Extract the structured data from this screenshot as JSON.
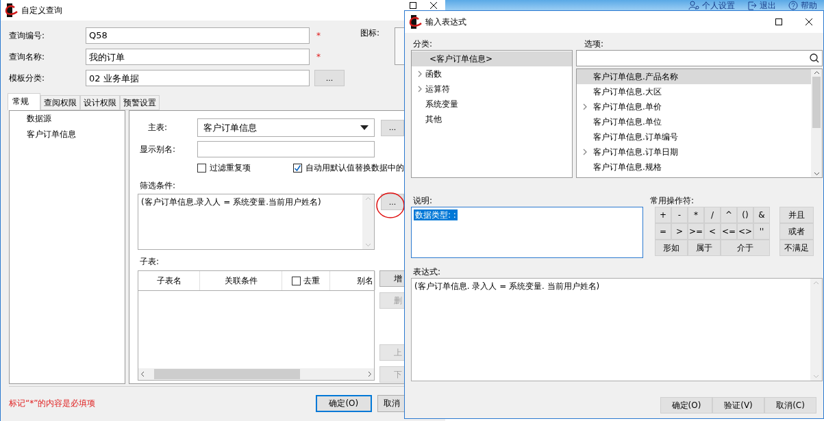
{
  "top_bar": {
    "links": [
      {
        "label": "个人设置"
      },
      {
        "label": "退出"
      },
      {
        "label": "帮助"
      }
    ]
  },
  "main_window": {
    "title": "自定义查询",
    "fields": [
      {
        "label": "查询编号:",
        "value": "Q58",
        "required": true
      },
      {
        "label": "查询名称:",
        "value": "我的订单",
        "required": true
      },
      {
        "label": "模板分类:",
        "value": "02 业务单据",
        "required": false,
        "browse": "..."
      }
    ],
    "icon_label": "图标:",
    "tabs": [
      {
        "label": "常规",
        "selected": true
      },
      {
        "label": "查阅权限",
        "selected": false
      },
      {
        "label": "设计权限",
        "selected": false
      },
      {
        "label": "预警设置",
        "selected": false
      }
    ],
    "tree": [
      {
        "label": "数据源"
      },
      {
        "label": "客户订单信息"
      }
    ],
    "main_table": {
      "label": "主表:",
      "value": "客户订单信息",
      "browse": "..."
    },
    "alias": {
      "label": "显示别名:"
    },
    "options": [
      {
        "label": "过滤重复项",
        "checked": false
      },
      {
        "label": "自动用默认值替换数据中的",
        "checked": true
      }
    ],
    "filter": {
      "label": "筛选条件:",
      "value": "(客户订单信息.录入人 = 系统变量.当前用户姓名)",
      "browse": "..."
    },
    "subtable": {
      "label": "子表:",
      "columns": [
        {
          "label": "子表名",
          "kind": "text"
        },
        {
          "label": "关联条件",
          "kind": "text"
        },
        {
          "label": "去重",
          "kind": "checkbox",
          "checked": false
        },
        {
          "label": "别名",
          "kind": "text"
        }
      ],
      "buttons": [
        {
          "label": "增",
          "disabled": false
        },
        {
          "label": "删",
          "disabled": true
        },
        {
          "label": "上",
          "disabled": true
        },
        {
          "label": "下",
          "disabled": true
        }
      ]
    },
    "footer": {
      "note": "标记“*”的内容是必填项",
      "buttons": [
        {
          "label": "确定(O)",
          "default": true
        },
        {
          "label": "取消",
          "default": false
        }
      ]
    }
  },
  "dialog": {
    "title": "输入表达式",
    "category": {
      "label": "分类:",
      "items": [
        {
          "label": "<客户订单信息>",
          "selected": true,
          "expandable": false
        },
        {
          "label": "函数",
          "selected": false,
          "expandable": true
        },
        {
          "label": "运算符",
          "selected": false,
          "expandable": true
        },
        {
          "label": "系统变量",
          "selected": false,
          "expandable": false
        },
        {
          "label": "其他",
          "selected": false,
          "expandable": false
        }
      ]
    },
    "options": {
      "label": "选项:",
      "items": [
        {
          "label": "客户订单信息.产品名称",
          "selected": true,
          "expandable": false
        },
        {
          "label": "客户订单信息.大区",
          "selected": false,
          "expandable": false
        },
        {
          "label": "客户订单信息.单价",
          "selected": false,
          "expandable": true
        },
        {
          "label": "客户订单信息.单位",
          "selected": false,
          "expandable": false
        },
        {
          "label": "客户订单信息.订单编号",
          "selected": false,
          "expandable": false
        },
        {
          "label": "客户订单信息.订单日期",
          "selected": false,
          "expandable": true
        },
        {
          "label": "客户订单信息.规格",
          "selected": false,
          "expandable": false
        }
      ]
    },
    "description": {
      "label": "说明:",
      "value": "数据类型: :"
    },
    "operators": {
      "label": "常用操作符:",
      "rows": [
        [
          {
            "label": "+"
          },
          {
            "label": "-"
          },
          {
            "label": "*"
          },
          {
            "label": "/"
          },
          {
            "label": "^"
          },
          {
            "label": "()"
          },
          {
            "label": "&"
          }
        ],
        [
          {
            "label": "="
          },
          {
            "label": ">"
          },
          {
            "label": ">="
          },
          {
            "label": "<"
          },
          {
            "label": "<="
          },
          {
            "label": "<>"
          },
          {
            "label": "''"
          }
        ]
      ],
      "word_keys": [
        "形如",
        "属于",
        "介于"
      ],
      "logic": [
        "并且",
        "或者",
        "不满足"
      ]
    },
    "expression": {
      "label": "表达式:",
      "value": "(客户订单信息. 录入人 = 系统变量. 当前用户姓名)"
    },
    "buttons": [
      "确定(O)",
      "验证(V)",
      "取消(C)"
    ]
  }
}
